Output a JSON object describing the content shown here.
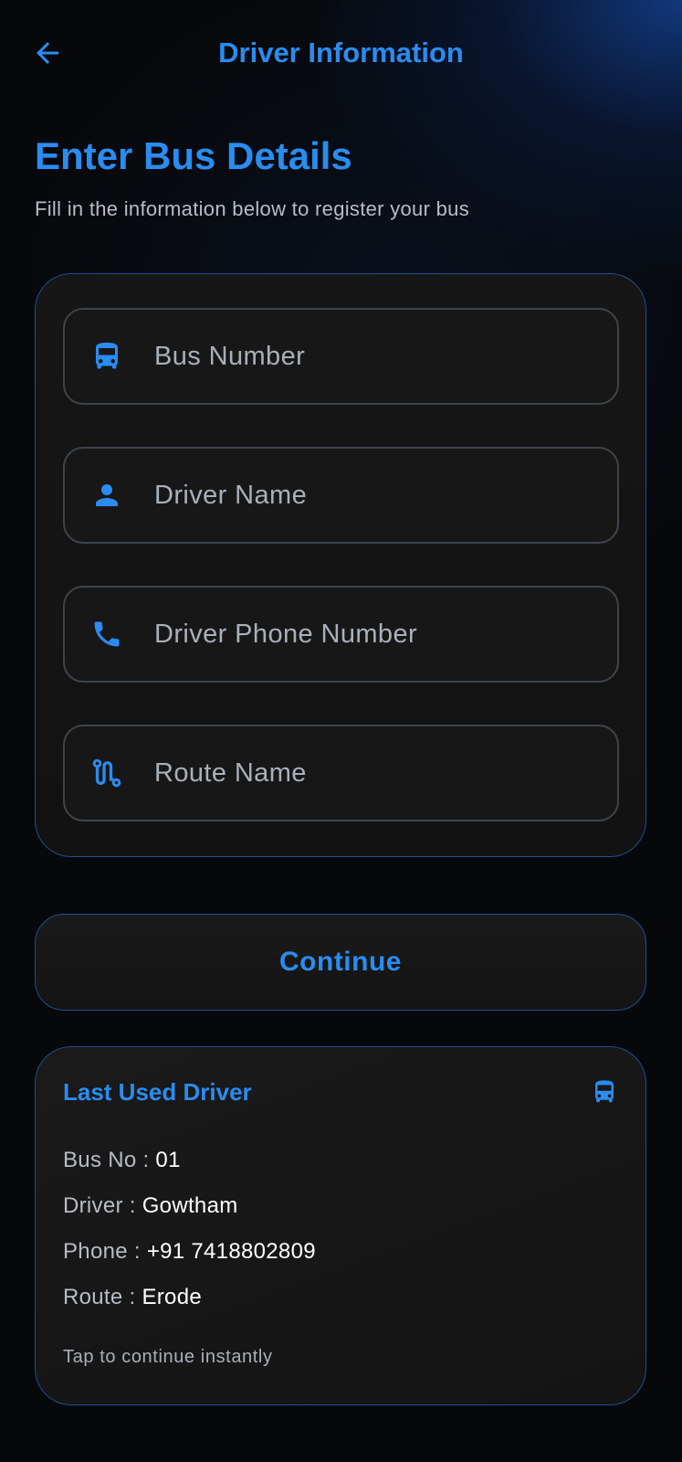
{
  "header": {
    "title": "Driver Information",
    "back_icon": "arrow-back-icon"
  },
  "page": {
    "heading": "Enter Bus Details",
    "subtitle": "Fill in the information below to register your bus"
  },
  "form": {
    "fields": [
      {
        "icon": "bus-icon",
        "placeholder": "Bus Number",
        "value": ""
      },
      {
        "icon": "person-icon",
        "placeholder": "Driver Name",
        "value": ""
      },
      {
        "icon": "phone-icon",
        "placeholder": "Driver Phone Number",
        "value": ""
      },
      {
        "icon": "route-icon",
        "placeholder": "Route Name",
        "value": ""
      }
    ]
  },
  "continue_button": {
    "label": "Continue"
  },
  "last_used": {
    "title": "Last Used Driver",
    "icon": "bus-icon",
    "rows": [
      {
        "label": "Bus No",
        "value": "01"
      },
      {
        "label": "Driver",
        "value": "Gowtham"
      },
      {
        "label": "Phone",
        "value": "+91 7418802809"
      },
      {
        "label": "Route",
        "value": "Erode"
      }
    ],
    "hint": "Tap to continue instantly"
  },
  "colors": {
    "accent": "#2a8cf0",
    "background": "#07080a",
    "card_border": "#1f4e95",
    "field_border": "#3e444b",
    "muted_text": "#b8bcc4"
  }
}
